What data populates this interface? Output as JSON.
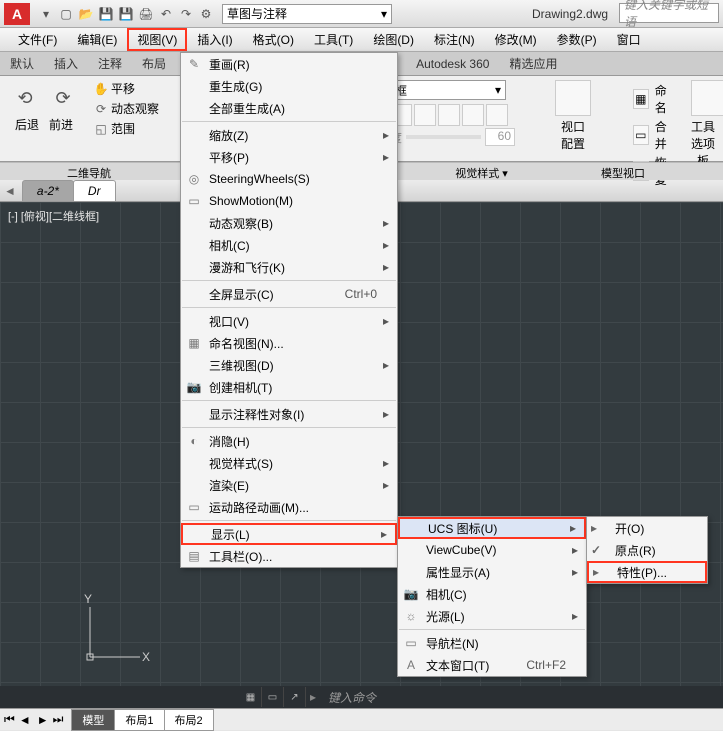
{
  "title_bar": {
    "file_name": "Drawing2.dwg",
    "search_placeholder": "键入关键字或短语",
    "workspace": "草图与注释"
  },
  "menu": {
    "file": "文件(F)",
    "edit": "编辑(E)",
    "view": "视图(V)",
    "insert": "插入(I)",
    "format": "格式(O)",
    "tools": "工具(T)",
    "draw": "绘图(D)",
    "dimension": "标注(N)",
    "modify": "修改(M)",
    "params": "参数(P)",
    "window": "窗口"
  },
  "ribbon_tabs": {
    "default": "默认",
    "insert": "插入",
    "annotate": "注释",
    "layout": "布局",
    "autodesk360": "Autodesk 360",
    "featured": "精选应用"
  },
  "ribbon": {
    "nav": {
      "back": "后退",
      "forward": "前进",
      "group": "二维导航",
      "pan": "平移",
      "orbit": "动态观察",
      "extents": "范围"
    },
    "vstyle": {
      "wireframe": "维线框",
      "trans": "透明度",
      "trans_val": "60",
      "group": "视觉样式 ▾"
    },
    "vp": {
      "viewport": "视口",
      "config": "配置",
      "named": "命名",
      "merge": "合并",
      "restore": "恢复",
      "group": "模型视口"
    },
    "tools": {
      "tool": "工具",
      "palettes": "选项板"
    }
  },
  "tabs": {
    "a2": "a-2*",
    "dr": "Dr"
  },
  "viewport_label": "[-] [俯视][二维线框]",
  "view_menu": {
    "redraw": "重画(R)",
    "regen": "重生成(G)",
    "regenall": "全部重生成(A)",
    "zoom": "缩放(Z)",
    "pan": "平移(P)",
    "steering": "SteeringWheels(S)",
    "showmotion": "ShowMotion(M)",
    "orbit": "动态观察(B)",
    "camera": "相机(C)",
    "walk": "漫游和飞行(K)",
    "fullscreen": "全屏显示(C)",
    "fs_key": "Ctrl+0",
    "viewports": "视口(V)",
    "named": "命名视图(N)...",
    "3dviews": "三维视图(D)",
    "createcam": "创建相机(T)",
    "annotative": "显示注释性对象(I)",
    "hide": "消隐(H)",
    "vstyles": "视觉样式(S)",
    "render": "渲染(E)",
    "motion": "运动路径动画(M)...",
    "display": "显示(L)",
    "toolbars": "工具栏(O)..."
  },
  "display_sub": {
    "ucs": "UCS 图标(U)",
    "viewcube": "ViewCube(V)",
    "attr": "属性显示(A)",
    "camera": "相机(C)",
    "light": "光源(L)",
    "navbar": "导航栏(N)",
    "textwin": "文本窗口(T)",
    "tw_key": "Ctrl+F2"
  },
  "ucs_sub": {
    "on": "开(O)",
    "origin": "原点(R)",
    "props": "特性(P)..."
  },
  "layout": {
    "model": "模型",
    "l1": "布局1",
    "l2": "布局2"
  },
  "cmd_hint": "键入命令"
}
